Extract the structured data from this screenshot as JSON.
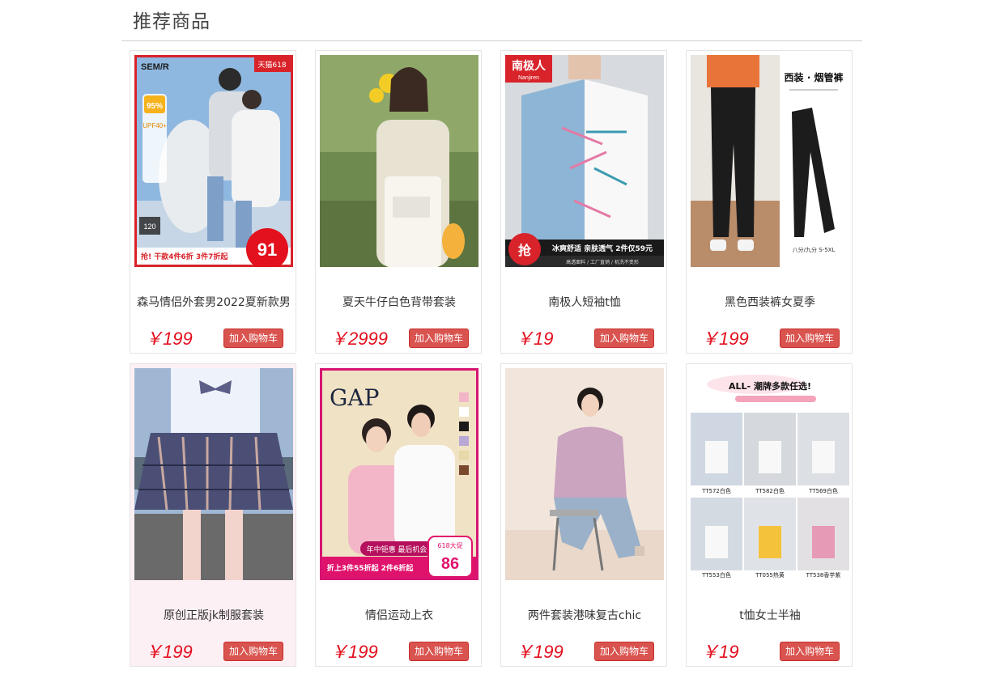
{
  "section": {
    "title": "推荐商品"
  },
  "products": [
    {
      "name": "森马情侣外套男2022夏新款男",
      "price": "￥199",
      "cart_label": "加入购物车",
      "image": {
        "brand": "SEM/R",
        "corner_tag": "天猫618",
        "badges": [
          "95%",
          "UPF40+",
          "120"
        ],
        "bottom_banner": "抢! 干款4件6折 3件7折起",
        "promo_price": "91"
      }
    },
    {
      "name": "夏天牛仔白色背带套装",
      "price": "￥2999",
      "cart_label": "加入购物车",
      "image": {}
    },
    {
      "name": "南极人短袖t恤",
      "price": "￥19",
      "cart_label": "加入购物车",
      "image": {
        "brand": "南极人",
        "brand_sub": "Nanjiren",
        "bottom_banner": "冰爽舒适 亲肤透气 2件仅59元",
        "grab": "抢",
        "sub_banner": "高透面料 / 工厂直销 / 机洗不变形"
      }
    },
    {
      "name": "黑色西装裤女夏季",
      "price": "￥199",
      "cart_label": "加入购物车",
      "image": {
        "heading": "西装 · 烟管裤",
        "size_note": "八分/九分 S-5XL"
      }
    },
    {
      "name": "原创正版jk制服套装",
      "price": "￥199",
      "cart_label": "加入购物车",
      "image": {}
    },
    {
      "name": "情侣运动上衣",
      "price": "￥199",
      "cart_label": "加入购物车",
      "image": {
        "brand": "GAP",
        "tag": "年中钜惠 最后机会",
        "bottom_banner": "折上3件55折起 2件6折起",
        "promo_label": "618大促",
        "promo_price": "86"
      }
    },
    {
      "name": "两件套装港味复古chic",
      "price": "￥199",
      "cart_label": "加入购物车",
      "image": {}
    },
    {
      "name": "t恤女士半袖",
      "price": "￥19",
      "cart_label": "加入购物车",
      "image": {
        "heading": "ALL- 潮牌多款任选!",
        "captions": [
          "TT572白色",
          "TT582白色",
          "TT569白色",
          "TT553白色",
          "TT055热黄",
          "TT538香芋紫"
        ]
      }
    }
  ],
  "colors": {
    "price": "#e3101e",
    "button": "#d9534f",
    "hover_bg": "#fdf0f5"
  }
}
